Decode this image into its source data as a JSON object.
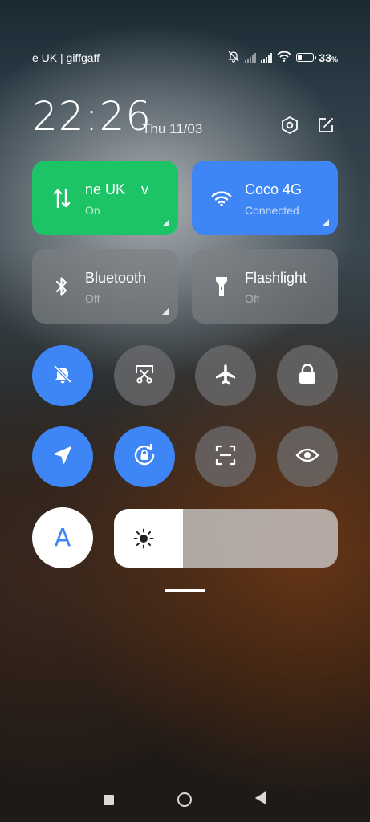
{
  "status_bar": {
    "carrier": "e UK | giffgaff",
    "battery_percent": "33",
    "battery_symbol": "%",
    "battery_level": 0.33
  },
  "header": {
    "time": "22:26",
    "date": "Thu 11/03",
    "settings_icon": "gear-hexagon-icon",
    "edit_icon": "edit-icon"
  },
  "tiles": [
    {
      "name": "ne UK    v",
      "status": "On",
      "icon": "mobile-data-icon",
      "color": "#1dc466"
    },
    {
      "name": "Coco 4G",
      "status": "Connected",
      "icon": "wifi-icon",
      "color": "#3e86f5"
    },
    {
      "name": "Bluetooth",
      "status": "Off",
      "icon": "bluetooth-icon",
      "color": "#7d8083"
    },
    {
      "name": "Flashlight",
      "status": "Off",
      "icon": "flashlight-icon",
      "color": "#7d8083"
    }
  ],
  "toggles": [
    {
      "name": "mute",
      "icon": "bell-off-icon",
      "active": true
    },
    {
      "name": "screenshot",
      "icon": "scissors-screenshot-icon",
      "active": false
    },
    {
      "name": "airplane-mode",
      "icon": "airplane-icon",
      "active": false
    },
    {
      "name": "lock-screen",
      "icon": "lock-icon",
      "active": false
    },
    {
      "name": "location",
      "icon": "location-arrow-icon",
      "active": true
    },
    {
      "name": "rotation-lock",
      "icon": "rotation-lock-icon",
      "active": true
    },
    {
      "name": "scanner",
      "icon": "scan-frame-icon",
      "active": false
    },
    {
      "name": "reading-mode",
      "icon": "eye-icon",
      "active": false
    }
  ],
  "auto_brightness": {
    "label": "A",
    "active": true
  },
  "brightness": {
    "level": 0.31,
    "icon": "sun-icon"
  },
  "nav": {
    "recents_icon": "square-icon",
    "home_icon": "circle-icon",
    "back_icon": "triangle-back-icon"
  }
}
